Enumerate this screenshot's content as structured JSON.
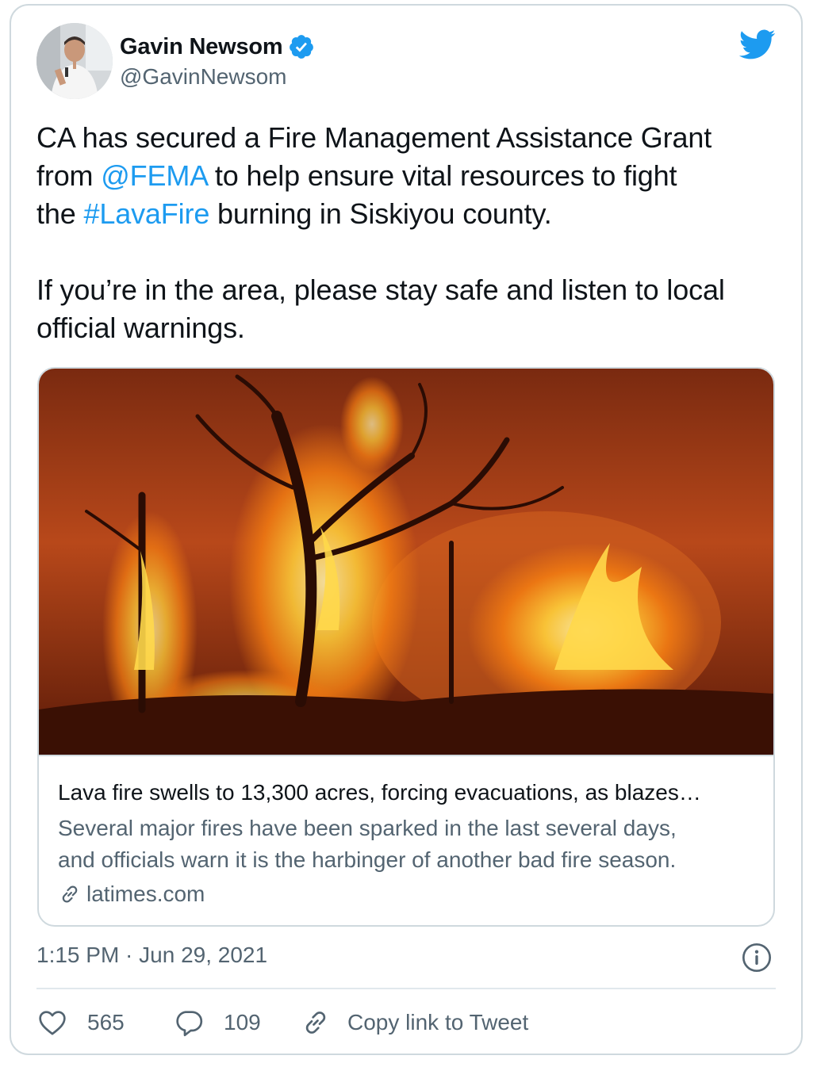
{
  "user": {
    "display_name": "Gavin Newsom",
    "handle": "@GavinNewsom",
    "verified": true,
    "avatar_icon": "profile-photo"
  },
  "brand": {
    "logo_icon": "twitter-bird-icon",
    "color": "#1d9bf0"
  },
  "tweet": {
    "line1": "CA has secured a Fire Management Assistance Grant",
    "line2_pre": "from ",
    "line2_mention": "@FEMA",
    "line2_post": " to help ensure vital resources to fight",
    "line3_pre": "the ",
    "line3_hashtag": "#LavaFire",
    "line3_post": " burning in Siskiyou county.",
    "line4": "If you’re in the area, please stay safe and listen to local",
    "line5": "official warnings."
  },
  "card": {
    "image_description_icon": "wildfire-photo",
    "title": "Lava fire swells to 13,300 acres, forcing evacuations, as blazes…",
    "desc_line1": "Several major fires have been sparked in the last several days,",
    "desc_line2": "and officials warn it is the harbinger of another bad fire season.",
    "domain": "latimes.com",
    "domain_icon": "link-icon"
  },
  "meta": {
    "timestamp": "1:15 PM · Jun 29, 2021",
    "info_icon": "info-icon"
  },
  "actions": {
    "likes": "565",
    "replies": "109",
    "copy_link": "Copy link to Tweet"
  },
  "colors": {
    "text": "#0f1419",
    "secondary": "#536471",
    "accent": "#1d9bf0",
    "border": "#cfd9de"
  }
}
